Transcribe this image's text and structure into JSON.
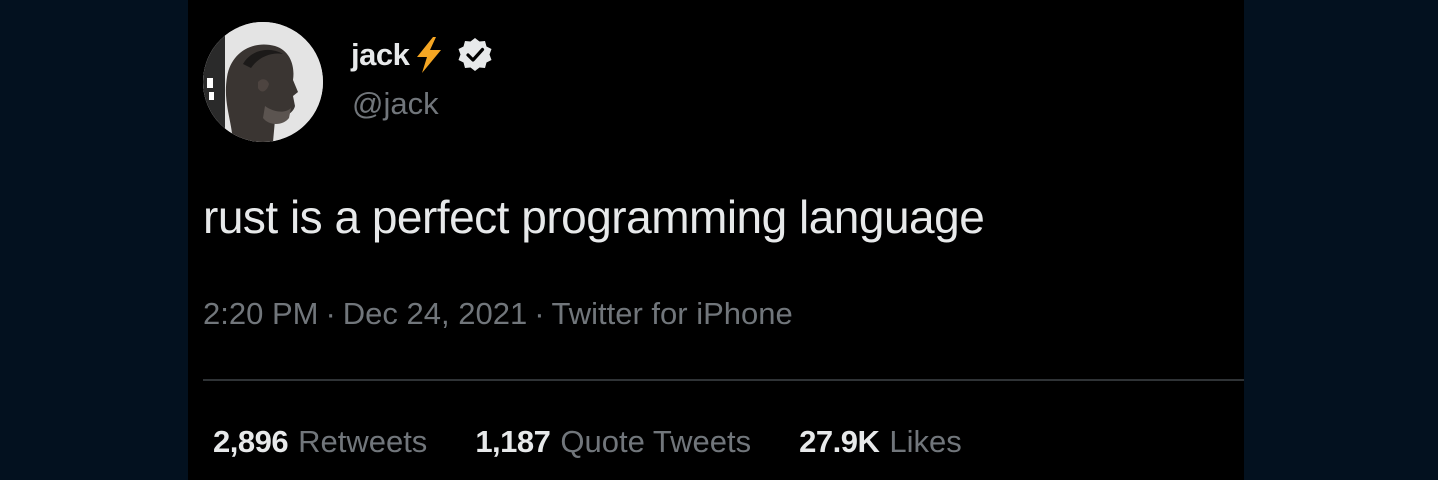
{
  "tweet": {
    "author": {
      "display_name": "jack",
      "name_emoji": "lightning-bolt",
      "verified_icon": "verified-badge",
      "handle": "@jack",
      "avatar_icon": "profile-photo"
    },
    "text": "rust is a perfect programming language",
    "meta": {
      "time": "2:20 PM",
      "separator_1": "·",
      "date": "Dec 24, 2021",
      "separator_2": "·",
      "source": "Twitter for iPhone"
    },
    "stats": {
      "retweets": {
        "count": "2,896",
        "label": "Retweets"
      },
      "quote_tweets": {
        "count": "1,187",
        "label": "Quote Tweets"
      },
      "likes": {
        "count": "27.9K",
        "label": "Likes"
      }
    }
  },
  "colors": {
    "page_background": "#03111f",
    "card_background": "#000000",
    "primary_text": "#e7e9ea",
    "secondary_text": "#71767b",
    "divider": "#2f3336",
    "bolt": "#f5a623"
  }
}
